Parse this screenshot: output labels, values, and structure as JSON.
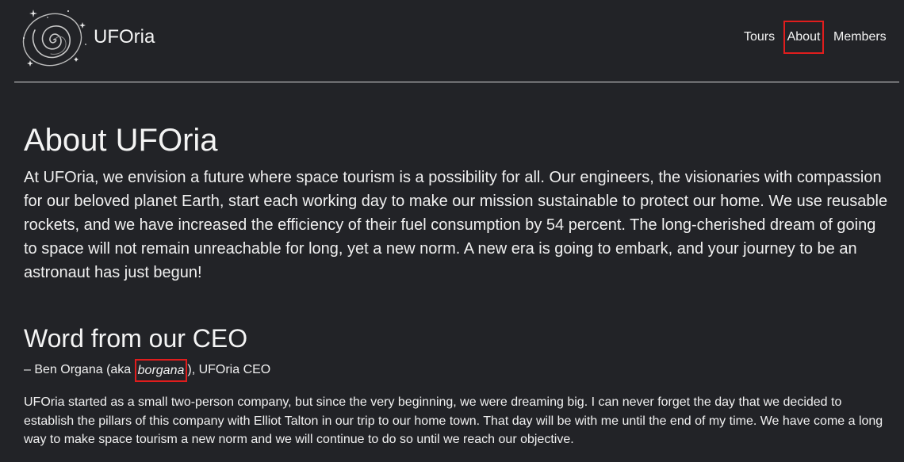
{
  "header": {
    "brand": "UFOria",
    "logo_icon": "galaxy-spiral-icon",
    "nav": {
      "tours": "Tours",
      "about": "About",
      "members": "Members"
    }
  },
  "main": {
    "title": "About UFOria",
    "intro": "At UFOria, we envision a future where space tourism is a possibility for all. Our engineers, the visionaries with compassion for our beloved planet Earth, start each working day to make our mission sustainable to protect our home. We use reusable rockets, and we have increased the efficiency of their fuel consumption by 54 percent. The long-cherished dream of going to space will not remain unreachable for long, yet a new norm. A new era is going to embark, and your journey to be an astronaut has just begun!",
    "ceo_heading": "Word from our CEO",
    "byline": {
      "prefix": "– Ben Organa (aka ",
      "handle": "borgana",
      "suffix": "), UFOria CEO"
    },
    "ceo_message": "UFOria started as a small two-person company, but since the very beginning, we were dreaming big. I can never forget the day that we decided to establish the pillars of this company with Elliot Talton in our trip to our home town. That day will be with me until the end of my time. We have come a long way to make space tourism a new norm and we will continue to do so until we reach our objective."
  },
  "colors": {
    "background": "#222327",
    "text": "#f2f2f2",
    "highlight_border": "#e01d1d",
    "divider": "#d8d8d8"
  }
}
